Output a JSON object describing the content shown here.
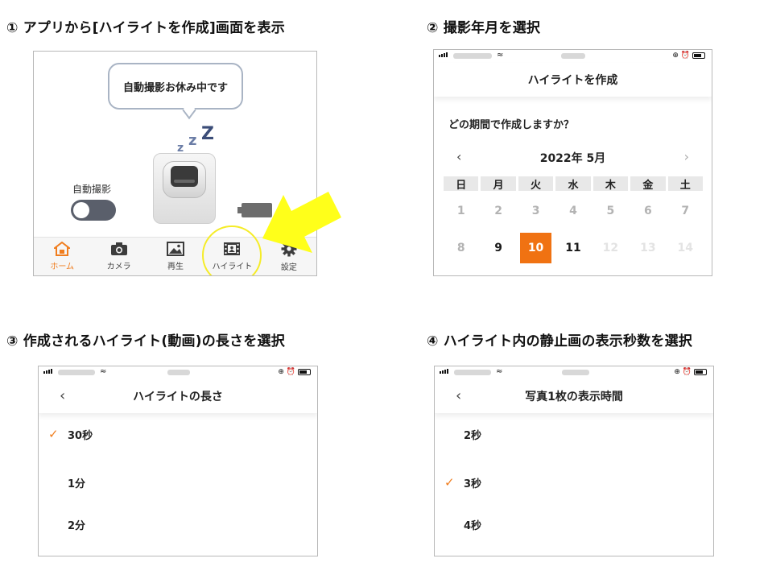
{
  "steps": {
    "s1": "① アプリから[ハイライトを作成]画面を表示",
    "s2": "② 撮影年月を選択",
    "s3": "③ 作成されるハイライト(動画)の長さを選択",
    "s4": "④ ハイライト内の静止画の表示秒数を選択"
  },
  "home": {
    "bubble_text": "自動撮影お休み中です",
    "zz": [
      "z",
      "z",
      "Z"
    ],
    "auto_label": "自動撮影",
    "toggle_on": false,
    "tabs": [
      {
        "label": "ホーム",
        "icon": "home-icon",
        "active": true
      },
      {
        "label": "カメラ",
        "icon": "camera-icon",
        "active": false
      },
      {
        "label": "再生",
        "icon": "image-icon",
        "active": false
      },
      {
        "label": "ハイライト",
        "icon": "film-icon",
        "active": false
      },
      {
        "label": "設定",
        "icon": "gear-icon",
        "active": false
      }
    ]
  },
  "calendar_screen": {
    "title": "ハイライトを作成",
    "question": "どの期間で作成しますか？",
    "month": "2022年 5月",
    "prev": "‹",
    "next": "›",
    "weekdays": [
      "日",
      "月",
      "火",
      "水",
      "木",
      "金",
      "土"
    ],
    "row1": [
      "1",
      "2",
      "3",
      "4",
      "5",
      "6",
      "7"
    ],
    "row2": [
      "8",
      "9",
      "10",
      "11",
      "12",
      "13",
      "14"
    ],
    "selected_day": "10"
  },
  "length_screen": {
    "back": "‹",
    "title": "ハイライトの長さ",
    "items": [
      {
        "label": "30秒",
        "checked": true
      },
      {
        "label": "1分",
        "checked": false
      },
      {
        "label": "2分",
        "checked": false
      }
    ]
  },
  "duration_screen": {
    "back": "‹",
    "title": "写真1枚の表示時間",
    "items": [
      {
        "label": "2秒",
        "checked": false
      },
      {
        "label": "3秒",
        "checked": true
      },
      {
        "label": "4秒",
        "checked": false
      }
    ]
  },
  "colors": {
    "accent": "#f07212",
    "highlight_annotation": "#f5ec28",
    "toggle_off": "#5a5f6b"
  },
  "icons": {
    "check": "✓",
    "status_glyphs": "⊕ ⏰"
  }
}
